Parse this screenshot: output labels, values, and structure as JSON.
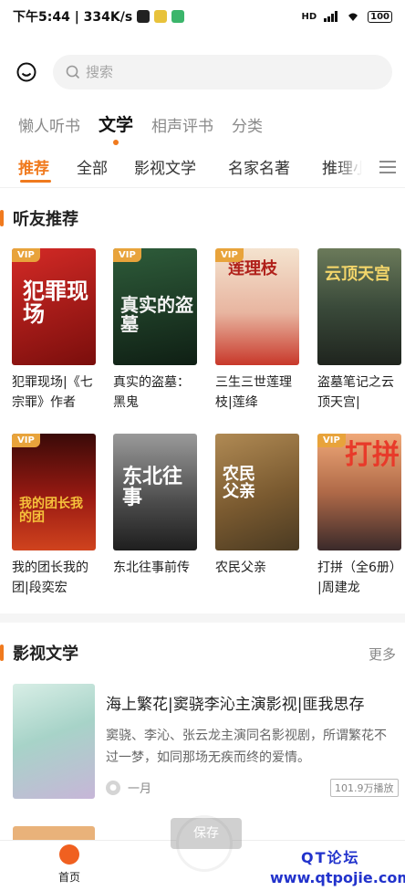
{
  "status_bar": {
    "time_speed": "下午5:44 | 334K/s",
    "signal": "HD",
    "battery": "100"
  },
  "search": {
    "placeholder": "搜索"
  },
  "main_tabs": [
    "懒人听书",
    "文学",
    "相声评书",
    "分类"
  ],
  "main_tab_active": "文学",
  "sub_tabs": [
    "推荐",
    "全部",
    "影视文学",
    "名家名著",
    "推理小"
  ],
  "sub_tab_active": "推荐",
  "section_friends": {
    "title": "听友推荐",
    "books": [
      {
        "title": "犯罪现场|《七宗罪》作者",
        "vip": "VIP",
        "cover_text": "犯罪现场",
        "cover_color": "#b01a18"
      },
      {
        "title": "真实的盗墓：黑鬼",
        "vip": "VIP",
        "cover_text": "真实的盗墓",
        "cover_color": "#1f3d28"
      },
      {
        "title": "三生三世莲理枝|莲绛",
        "vip": "VIP",
        "cover_text": "莲理枝",
        "cover_color": "#d04a3a"
      },
      {
        "title": "盗墓笔记之云顶天宫|",
        "vip": "",
        "cover_text": "云顶天宫",
        "cover_color": "#3a4a3a"
      },
      {
        "title": "我的团长我的团|段奕宏",
        "vip": "VIP",
        "cover_text": "我的团长我的团",
        "cover_color": "#6b1410"
      },
      {
        "title": "东北往事前传",
        "vip": "",
        "cover_text": "东北往事",
        "cover_color": "#3a3a3a"
      },
      {
        "title": "农民父亲",
        "vip": "",
        "cover_text": "农民父亲",
        "cover_color": "#8a6a3a"
      },
      {
        "title": "打拼（全6册）|周建龙",
        "vip": "VIP",
        "cover_text": "打拼",
        "cover_color": "#c5652a"
      }
    ]
  },
  "section_film": {
    "title": "影视文学",
    "more": "更多",
    "featured": {
      "title": "海上繁花|窦骁李沁主演影视|匪我思存",
      "desc": "窦骁、李沁、张云龙主演同名影视剧，所谓繁花不过一梦，如同那场无疾而终的爱情。",
      "author": "一月",
      "plays": "101.9万播放"
    }
  },
  "bottom_nav": {
    "home_label": "首页"
  },
  "save_popup": "保存",
  "watermark": {
    "name": "QT论坛",
    "url": "www.qtpojie.com"
  },
  "colors": {
    "accent": "#f07a1e",
    "vip": "#e8a33b"
  },
  "icons": {
    "face": "smile-face-icon",
    "search": "search-icon",
    "menu": "menu-icon",
    "home": "home-icon",
    "author": "author-icon"
  }
}
